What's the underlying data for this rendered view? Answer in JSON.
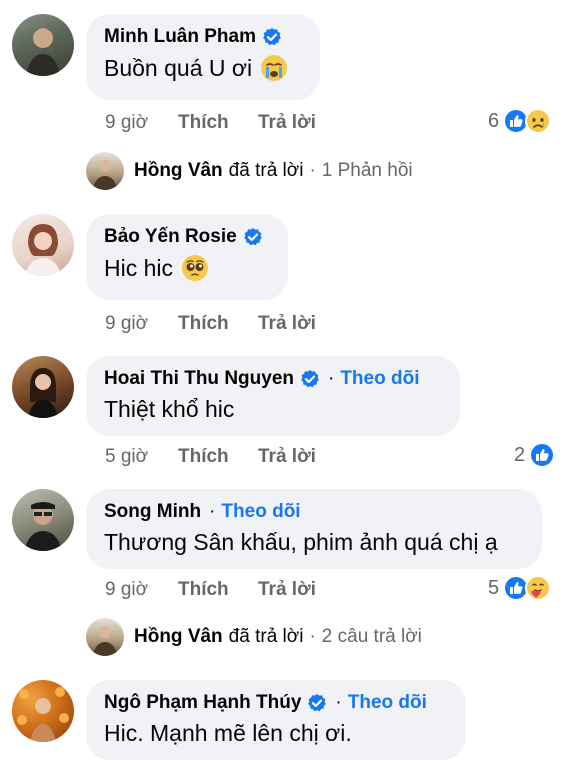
{
  "labels": {
    "like": "Thích",
    "reply": "Trả lời",
    "follow": "Theo dõi",
    "dot": "·"
  },
  "comments": [
    {
      "name": "Minh Luân Pham",
      "text": "Buồn quá U ơi",
      "emoji": "crying-face",
      "time": "9 giờ",
      "reactions": "6",
      "reaction_icons": [
        "like-icon",
        "sad-icon"
      ],
      "verified": true,
      "follow": false
    },
    {
      "name": "Bảo Yến Rosie",
      "text": "Hic hic",
      "emoji": "pleading-face",
      "time": "9 giờ",
      "reactions": "",
      "verified": true,
      "follow": false
    },
    {
      "name": "Hoai Thi Thu Nguyen",
      "text": "Thiệt khổ hic",
      "time": "5 giờ",
      "reactions": "2",
      "reaction_icons": [
        "like-icon"
      ],
      "verified": true,
      "follow": true
    },
    {
      "name": "Song Minh",
      "text": "Thương Sân khấu, phim ảnh quá chị ạ",
      "time": "9 giờ",
      "reactions": "5",
      "reaction_icons": [
        "like-icon",
        "care-icon"
      ],
      "verified": false,
      "follow": true
    },
    {
      "name": "Ngô Phạm Hạnh Thúy",
      "text": "Hic. Mạnh mẽ lên chị ơi.",
      "verified": true,
      "follow": true
    }
  ],
  "replies": [
    {
      "name": "Hồng Vân",
      "action": "đã trả lời",
      "count": "1 Phản hồi"
    },
    {
      "name": "Hồng Vân",
      "action": "đã trả lời",
      "count": "2 câu trả lời"
    }
  ],
  "colors": {
    "bubble": "#f0f2f5",
    "link": "#1877f2",
    "muted": "#65676b"
  }
}
